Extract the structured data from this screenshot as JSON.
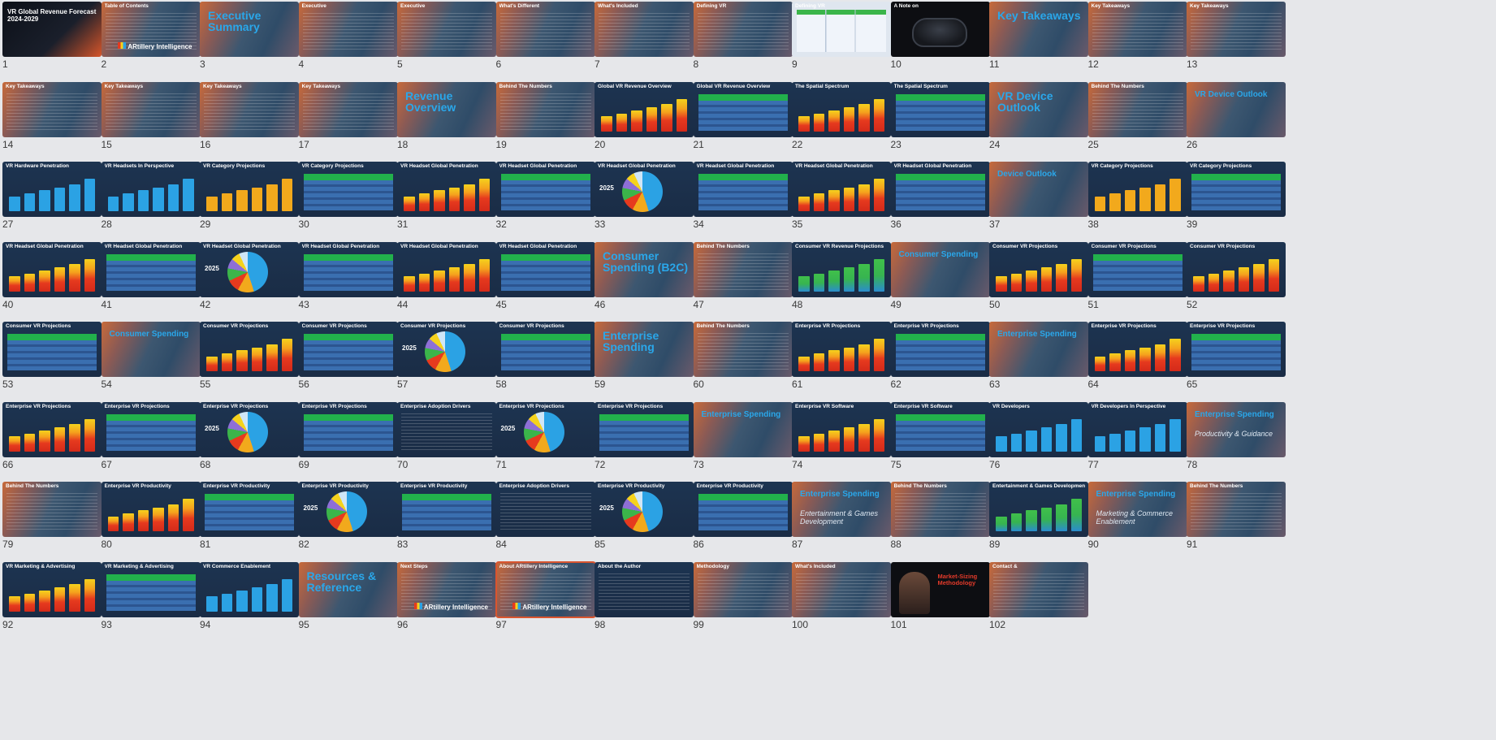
{
  "slides": [
    {
      "n": "1",
      "style": "cover",
      "title": "VR Global Revenue Forecast 2024-2029"
    },
    {
      "n": "2",
      "style": "toc",
      "title": "Table of Contents",
      "logo": "ARtillery Intelligence"
    },
    {
      "n": "3",
      "style": "section",
      "title": "Executive Summary"
    },
    {
      "n": "4",
      "style": "text",
      "title": "Executive"
    },
    {
      "n": "5",
      "style": "text",
      "title": "Executive"
    },
    {
      "n": "6",
      "style": "text",
      "title": "What's Different"
    },
    {
      "n": "7",
      "style": "text",
      "title": "What's Included"
    },
    {
      "n": "8",
      "style": "text",
      "title": "Defining VR"
    },
    {
      "n": "9",
      "style": "light",
      "title": "Defining VR"
    },
    {
      "n": "10",
      "style": "headset",
      "title": "A Note on"
    },
    {
      "n": "11",
      "style": "section",
      "title": "Key Takeaways"
    },
    {
      "n": "12",
      "style": "text",
      "title": "Key Takeaways"
    },
    {
      "n": "13",
      "style": "text",
      "title": "Key Takeaways"
    },
    {
      "n": "14",
      "style": "text",
      "title": "Key Takeaways"
    },
    {
      "n": "15",
      "style": "text",
      "title": "Key Takeaways"
    },
    {
      "n": "16",
      "style": "text",
      "title": "Key Takeaways"
    },
    {
      "n": "17",
      "style": "text",
      "title": "Key Takeaways"
    },
    {
      "n": "18",
      "style": "section",
      "title": "Revenue Overview"
    },
    {
      "n": "19",
      "style": "text",
      "title": "Behind The Numbers"
    },
    {
      "n": "20",
      "style": "bars",
      "title": "Global VR Revenue Overview"
    },
    {
      "n": "21",
      "style": "table",
      "title": "Global VR Revenue Overview"
    },
    {
      "n": "22",
      "style": "bars",
      "title": "The Spatial Spectrum"
    },
    {
      "n": "23",
      "style": "table",
      "title": "The Spatial Spectrum"
    },
    {
      "n": "24",
      "style": "section",
      "title": "VR Device Outlook"
    },
    {
      "n": "25",
      "style": "text",
      "title": "Behind The Numbers"
    },
    {
      "n": "26",
      "style": "section-sm",
      "title": "VR Device Outlook"
    },
    {
      "n": "27",
      "style": "bars-blue",
      "title": "VR Hardware Penetration"
    },
    {
      "n": "28",
      "style": "bars-blue",
      "title": "VR Headsets In Perspective"
    },
    {
      "n": "29",
      "style": "bars-orange",
      "title": "VR Category Projections"
    },
    {
      "n": "30",
      "style": "table",
      "title": "VR Category Projections"
    },
    {
      "n": "31",
      "style": "bars",
      "title": "VR Headset Global Penetration"
    },
    {
      "n": "32",
      "style": "table",
      "title": "VR Headset Global Penetration"
    },
    {
      "n": "33",
      "style": "pie",
      "title": "VR Headset Global Penetration",
      "year": "2025"
    },
    {
      "n": "34",
      "style": "table",
      "title": "VR Headset Global Penetration"
    },
    {
      "n": "35",
      "style": "bars",
      "title": "VR Headset Global Penetration"
    },
    {
      "n": "36",
      "style": "table",
      "title": "VR Headset Global Penetration"
    },
    {
      "n": "37",
      "style": "section-sm",
      "title": "Device Outlook"
    },
    {
      "n": "38",
      "style": "bars-orange",
      "title": "VR Category Projections"
    },
    {
      "n": "39",
      "style": "table",
      "title": "VR Category Projections"
    },
    {
      "n": "40",
      "style": "bars",
      "title": "VR Headset Global Penetration"
    },
    {
      "n": "41",
      "style": "table",
      "title": "VR Headset Global Penetration"
    },
    {
      "n": "42",
      "style": "pie",
      "title": "VR Headset Global Penetration",
      "year": "2025"
    },
    {
      "n": "43",
      "style": "table",
      "title": "VR Headset Global Penetration"
    },
    {
      "n": "44",
      "style": "bars",
      "title": "VR Headset Global Penetration"
    },
    {
      "n": "45",
      "style": "table",
      "title": "VR Headset Global Penetration"
    },
    {
      "n": "46",
      "style": "section",
      "title": "Consumer Spending (B2C)"
    },
    {
      "n": "47",
      "style": "text",
      "title": "Behind The Numbers"
    },
    {
      "n": "48",
      "style": "bars-green",
      "title": "Consumer VR Revenue Projections"
    },
    {
      "n": "49",
      "style": "section-sm",
      "title": "Consumer Spending"
    },
    {
      "n": "50",
      "style": "bars",
      "title": "Consumer VR Projections"
    },
    {
      "n": "51",
      "style": "table",
      "title": "Consumer VR Projections"
    },
    {
      "n": "52",
      "style": "bars",
      "title": "Consumer VR Projections"
    },
    {
      "n": "53",
      "style": "table",
      "title": "Consumer VR Projections"
    },
    {
      "n": "54",
      "style": "section-sm",
      "title": "Consumer Spending"
    },
    {
      "n": "55",
      "style": "bars",
      "title": "Consumer VR Projections"
    },
    {
      "n": "56",
      "style": "table",
      "title": "Consumer VR Projections"
    },
    {
      "n": "57",
      "style": "pie",
      "title": "Consumer VR Projections",
      "year": "2025"
    },
    {
      "n": "58",
      "style": "table",
      "title": "Consumer VR Projections"
    },
    {
      "n": "59",
      "style": "section",
      "title": "Enterprise Spending"
    },
    {
      "n": "60",
      "style": "text",
      "title": "Behind The Numbers"
    },
    {
      "n": "61",
      "style": "bars",
      "title": "Enterprise VR Projections"
    },
    {
      "n": "62",
      "style": "table",
      "title": "Enterprise VR Projections"
    },
    {
      "n": "63",
      "style": "section-sm",
      "title": "Enterprise Spending"
    },
    {
      "n": "64",
      "style": "bars",
      "title": "Enterprise VR Projections"
    },
    {
      "n": "65",
      "style": "table",
      "title": "Enterprise VR Projections"
    },
    {
      "n": "66",
      "style": "bars",
      "title": "Enterprise VR Projections"
    },
    {
      "n": "67",
      "style": "table",
      "title": "Enterprise VR Projections"
    },
    {
      "n": "68",
      "style": "pie",
      "title": "Enterprise VR Projections",
      "year": "2025"
    },
    {
      "n": "69",
      "style": "table",
      "title": "Enterprise VR Projections"
    },
    {
      "n": "70",
      "style": "scatter",
      "title": "Enterprise Adoption Drivers"
    },
    {
      "n": "71",
      "style": "pie",
      "title": "Enterprise VR Projections",
      "year": "2025"
    },
    {
      "n": "72",
      "style": "table",
      "title": "Enterprise VR Projections"
    },
    {
      "n": "73",
      "style": "section-sm",
      "title": "Enterprise Spending"
    },
    {
      "n": "74",
      "style": "bars",
      "title": "Enterprise VR Software"
    },
    {
      "n": "75",
      "style": "table",
      "title": "Enterprise VR Software"
    },
    {
      "n": "76",
      "style": "bars-blue",
      "title": "VR Developers"
    },
    {
      "n": "77",
      "style": "bars-blue",
      "title": "VR Developers In Perspective"
    },
    {
      "n": "78",
      "style": "section-2",
      "title": "Enterprise Spending",
      "subtitle": "Productivity & Guidance"
    },
    {
      "n": "79",
      "style": "text",
      "title": "Behind The Numbers"
    },
    {
      "n": "80",
      "style": "bars",
      "title": "Enterprise VR Productivity"
    },
    {
      "n": "81",
      "style": "table",
      "title": "Enterprise VR Productivity"
    },
    {
      "n": "82",
      "style": "pie",
      "title": "Enterprise VR Productivity",
      "year": "2025"
    },
    {
      "n": "83",
      "style": "table",
      "title": "Enterprise VR Productivity"
    },
    {
      "n": "84",
      "style": "scatter",
      "title": "Enterprise Adoption Drivers"
    },
    {
      "n": "85",
      "style": "pie",
      "title": "Enterprise VR Productivity",
      "year": "2025"
    },
    {
      "n": "86",
      "style": "table",
      "title": "Enterprise VR Productivity"
    },
    {
      "n": "87",
      "style": "section-2",
      "title": "Enterprise Spending",
      "subtitle": "Entertainment & Games Development"
    },
    {
      "n": "88",
      "style": "text",
      "title": "Behind The Numbers"
    },
    {
      "n": "89",
      "style": "bars-green",
      "title": "Entertainment & Games Development"
    },
    {
      "n": "90",
      "style": "section-2",
      "title": "Enterprise Spending",
      "subtitle": "Marketing & Commerce Enablement"
    },
    {
      "n": "91",
      "style": "text",
      "title": "Behind The Numbers"
    },
    {
      "n": "92",
      "style": "bars",
      "title": "VR Marketing & Advertising"
    },
    {
      "n": "93",
      "style": "table",
      "title": "VR Marketing & Advertising"
    },
    {
      "n": "94",
      "style": "bars-blue",
      "title": "VR Commerce Enablement"
    },
    {
      "n": "95",
      "style": "section",
      "title": "Resources & Reference"
    },
    {
      "n": "96",
      "style": "text",
      "title": "Next Steps",
      "logo": "ARtillery Intelligence"
    },
    {
      "n": "97",
      "style": "text",
      "title": "About ARtillery Intelligence",
      "logo": "ARtillery Intelligence",
      "selected": true
    },
    {
      "n": "98",
      "style": "dark",
      "title": "About the Author"
    },
    {
      "n": "99",
      "style": "text",
      "title": "Methodology"
    },
    {
      "n": "100",
      "style": "text",
      "title": "What's Included"
    },
    {
      "n": "101",
      "style": "video",
      "title": "Market-Sizing Methodology"
    },
    {
      "n": "102",
      "style": "text",
      "title": "Contact &"
    }
  ]
}
